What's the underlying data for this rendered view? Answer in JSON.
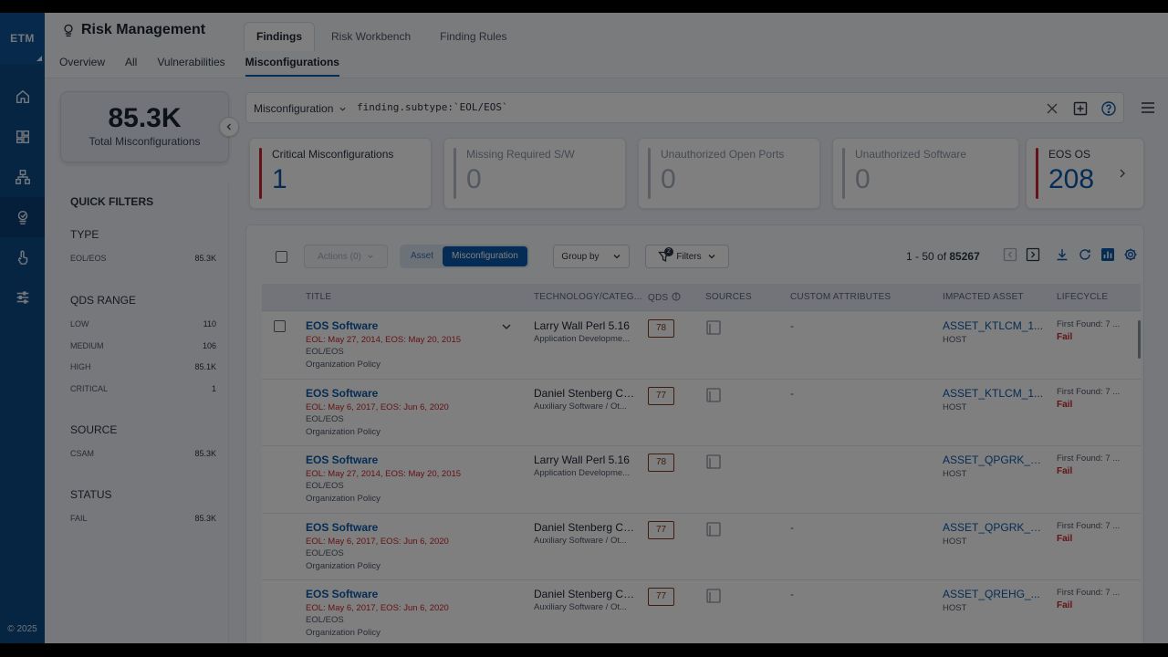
{
  "app": {
    "rail_logo": "ETM",
    "copyright": "© 2025",
    "rail_items": [
      "home-icon",
      "dashboard-icon",
      "hierarchy-icon",
      "risk-icon",
      "touch-icon",
      "sliders-icon"
    ]
  },
  "header": {
    "title": "Risk Management",
    "tabs": [
      {
        "label": "Findings",
        "active": true
      },
      {
        "label": "Risk Workbench",
        "active": false
      },
      {
        "label": "Finding Rules",
        "active": false
      }
    ],
    "subtabs": [
      {
        "label": "Overview",
        "active": false
      },
      {
        "label": "All",
        "active": false
      },
      {
        "label": "Vulnerabilities",
        "active": false
      },
      {
        "label": "Misconfigurations",
        "active": true
      }
    ]
  },
  "total": {
    "value": "85.3K",
    "label": "Total Misconfigurations"
  },
  "quick_filters": {
    "title": "QUICK FILTERS",
    "sections": [
      {
        "heading": "TYPE",
        "rows": [
          {
            "label": "EOL/EOS",
            "count": "85.3K"
          }
        ]
      },
      {
        "heading": "QDS RANGE",
        "rows": [
          {
            "label": "LOW",
            "count": "110"
          },
          {
            "label": "MEDIUM",
            "count": "106"
          },
          {
            "label": "HIGH",
            "count": "85.1K"
          },
          {
            "label": "CRITICAL",
            "count": "1"
          }
        ]
      },
      {
        "heading": "SOURCE",
        "rows": [
          {
            "label": "CSAM",
            "count": "85.3K"
          }
        ]
      },
      {
        "heading": "STATUS",
        "rows": [
          {
            "label": "FAIL",
            "count": "85.3K"
          }
        ]
      }
    ]
  },
  "query": {
    "field": "Misconfiguration",
    "text": "finding.subtype:`EOL/EOS`"
  },
  "cards": [
    {
      "title": "Critical Misconfigurations",
      "value": "1",
      "critical": true
    },
    {
      "title": "Missing Required S/W",
      "value": "0",
      "critical": false
    },
    {
      "title": "Unauthorized Open Ports",
      "value": "0",
      "critical": false
    },
    {
      "title": "Unauthorized Software",
      "value": "0",
      "critical": false
    },
    {
      "title": "EOS OS",
      "value": "208",
      "critical": true
    }
  ],
  "toolbar": {
    "actions": "Actions (0)",
    "seg_asset": "Asset",
    "seg_misconfig": "Misconfiguration",
    "group_by": "Group by",
    "filters": "Filters",
    "filters_count": "2",
    "pager_range": "1 - 50 of",
    "pager_total": "85267"
  },
  "table": {
    "headers": {
      "title": "TITLE",
      "tech": "TECHNOLOGY/CATEG...",
      "qds": "QDS",
      "sources": "SOURCES",
      "attrs": "CUSTOM ATTRIBUTES",
      "asset": "IMPACTED ASSET",
      "lifecycle": "LIFECYCLE"
    },
    "rows": [
      {
        "title": "EOS Software",
        "dates": "EOL: May 27, 2014, EOS: May 20, 2015",
        "type": "EOL/EOS",
        "policy": "Organization Policy",
        "tech": "Larry Wall Perl 5.16",
        "category": "Application Developme...",
        "qds": "78",
        "attr": "-",
        "asset": "ASSET_KTLCM_1...",
        "asset_type": "HOST",
        "first_found": "First Found: 7 ...",
        "status": "Fail"
      },
      {
        "title": "EOS Software",
        "dates": "EOL: May 6, 2017, EOS: Jun 6, 2020",
        "type": "EOL/EOS",
        "policy": "Organization Policy",
        "tech": "Daniel Stenberg Cur...",
        "category": "Auxiliary Software / Ot...",
        "qds": "77",
        "attr": "-",
        "asset": "ASSET_KTLCM_1...",
        "asset_type": "HOST",
        "first_found": "First Found: 7 ...",
        "status": "Fail"
      },
      {
        "title": "EOS Software",
        "dates": "EOL: May 27, 2014, EOS: May 20, 2015",
        "type": "EOL/EOS",
        "policy": "Organization Policy",
        "tech": "Larry Wall Perl 5.16",
        "category": "Application Developme...",
        "qds": "78",
        "attr": "-",
        "asset": "ASSET_QPGRK_1...",
        "asset_type": "HOST",
        "first_found": "First Found: 7 ...",
        "status": "Fail"
      },
      {
        "title": "EOS Software",
        "dates": "EOL: May 6, 2017, EOS: Jun 6, 2020",
        "type": "EOL/EOS",
        "policy": "Organization Policy",
        "tech": "Daniel Stenberg Cur...",
        "category": "Auxiliary Software / Ot...",
        "qds": "77",
        "attr": "-",
        "asset": "ASSET_QPGRK_1...",
        "asset_type": "HOST",
        "first_found": "First Found: 7 ...",
        "status": "Fail"
      },
      {
        "title": "EOS Software",
        "dates": "EOL: May 6, 2017, EOS: Jun 6, 2020",
        "type": "EOL/EOS",
        "policy": "Organization Policy",
        "tech": "Daniel Stenberg Cur...",
        "category": "Auxiliary Software / Ot...",
        "qds": "77",
        "attr": "-",
        "asset": "ASSET_QREHG_...",
        "asset_type": "HOST",
        "first_found": "First Found: 7 ...",
        "status": "Fail"
      }
    ]
  },
  "colors": {
    "brand": "#0b4a86",
    "accent": "#0b58a8",
    "critical": "#c8242a"
  }
}
